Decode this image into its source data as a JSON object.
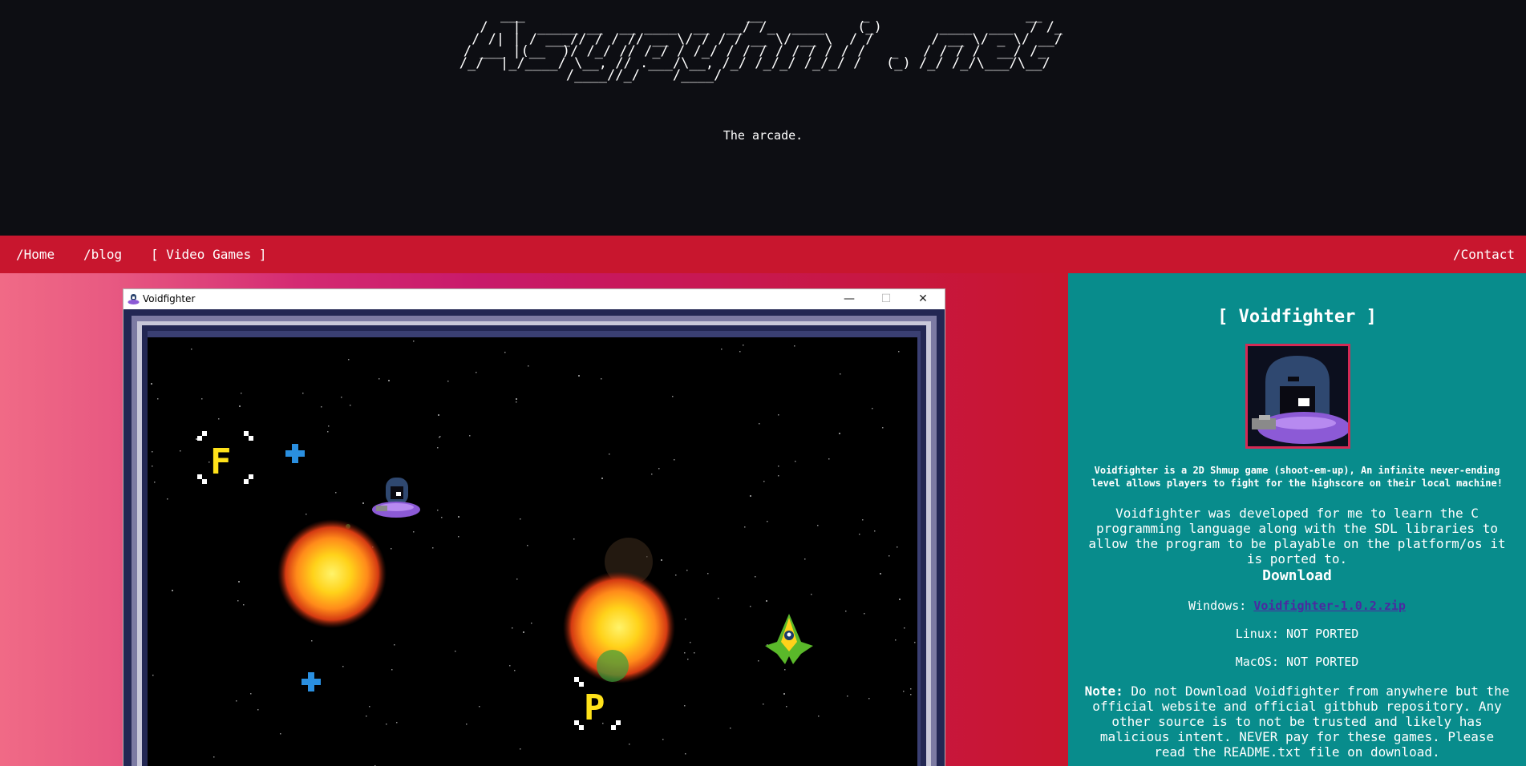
{
  "header": {
    "ascii_logo": "   ___                           __            _                   __ \n  /   |  _____ __  __ ____  __  __/ /_  ____    (_)       ____  ___  / /_\n / /| | / ___// / / // __ \\/ / / / __ \\/ __ \\  / /       / __ \\/ _ \\/ __/\n/ ___ |(__  )/ /_/ // /_/ / /_/ / / / / / / / / /   _   / / / /  __/ /_  \n/_/  |_/____/ \\__, // .___/\\__, /_/ /_/_/ /_/_/ /   (_) /_/ /_/\\___/\\__/  \n             /____//_/    /____/                                          ",
    "tagline": "The arcade."
  },
  "nav": {
    "home": "/Home",
    "blog": "/blog",
    "video_games": "[ Video Games ]",
    "contact": "/Contact"
  },
  "window": {
    "title": "Voidfighter",
    "minimize": "—",
    "maximize": "☐",
    "close": "✕"
  },
  "game": {
    "pickup_letter_1": "F",
    "pickup_letter_2": "P"
  },
  "panel": {
    "title": "[ Voidfighter ]",
    "intro": "Voidfighter is a 2D Shmup game (shoot-em-up), An infinite never-ending level allows players to fight for the highscore on their local machine!",
    "description": "Voidfighter was developed for me to learn the C programming language along with the SDL libraries to allow the program to be playable on the platform/os it is ported to.",
    "download_title": "Download",
    "windows_label": "Windows: ",
    "windows_link": "Voidfighter-1.0.2.zip",
    "linux": "Linux: NOT PORTED",
    "macos": "MacOS: NOT PORTED",
    "note_label": "Note:",
    "note_text": " Do not Download Voidfighter from anywhere but the official website and official gitbhub repository. Any other source is to not be trusted and likely has malicious intent. NEVER pay for these games. Please read the README.txt file on download."
  },
  "colors": {
    "header_bg": "#0d0e13",
    "nav_bg": "#c8162e",
    "panel_bg": "#088c8c",
    "link_color": "#4b2aa0",
    "game_frame": "#232753"
  }
}
